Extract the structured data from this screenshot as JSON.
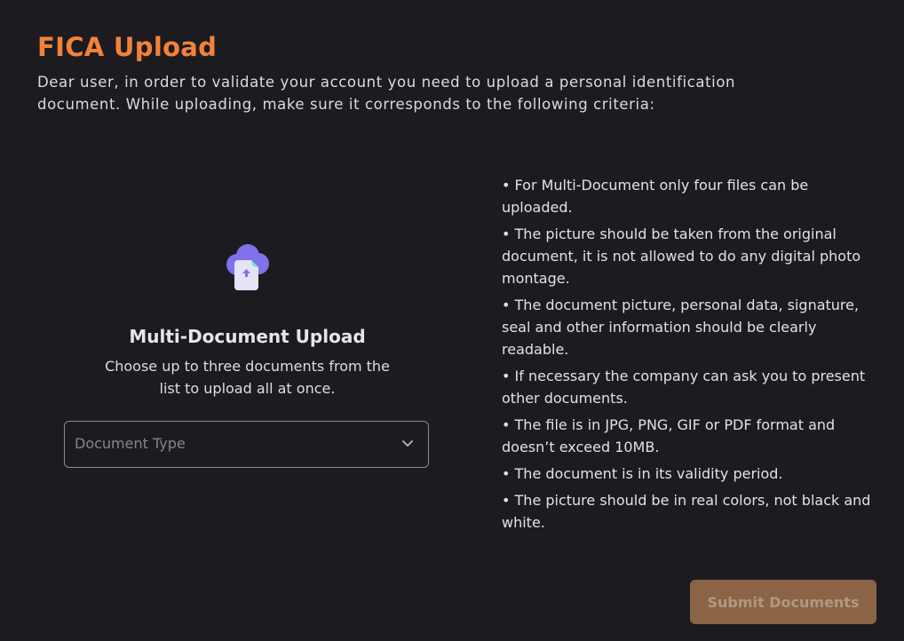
{
  "header": {
    "title": "FICA Upload",
    "intro": "Dear user, in order to validate your account you need to upload a personal identification document. While uploading, make sure it corresponds to the following criteria:"
  },
  "upload": {
    "icon": "cloud-upload-icon",
    "heading": "Multi-Document Upload",
    "description": "Choose up to three documents from the list to upload all at once.",
    "select_placeholder": "Document Type",
    "select_icon": "chevron-down-icon"
  },
  "criteria": [
    "• For Multi-Document only four files can be uploaded.",
    "• The picture should be taken from the original document, it is not allowed to do any digital photo montage.",
    "• The document picture, personal data, signature, seal and other information should be clearly readable.",
    "• If necessary the company can ask you to present other documents.",
    "• The file is in JPG, PNG, GIF or PDF format and doesn’t exceed 10MB.",
    "• The document is in its validity period.",
    "• The picture should be in real colors, not black and white."
  ],
  "actions": {
    "submit_label": "Submit Documents"
  },
  "colors": {
    "background": "#1c1b20",
    "accent": "#f2823a",
    "submit_disabled": "#8a6445"
  }
}
